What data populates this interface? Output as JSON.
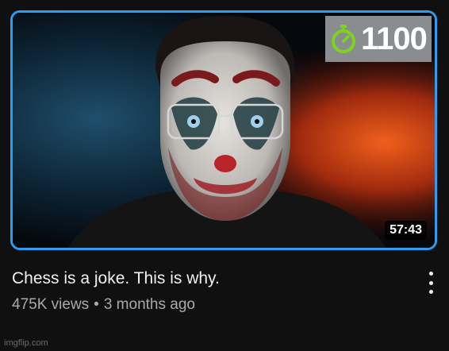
{
  "video": {
    "rating": "1100",
    "duration": "57:43",
    "title": "Chess is a joke. This is why.",
    "views": "475K views",
    "separator": "•",
    "age": "3 months ago"
  },
  "watermark": "imgflip.com",
  "colors": {
    "thumbnail_border": "#2e9cf0",
    "badge_background": "#8a8d90",
    "clock_icon": "#7ed321"
  },
  "icons": {
    "rating_badge": "stopwatch-icon",
    "menu": "more-vert-icon"
  }
}
